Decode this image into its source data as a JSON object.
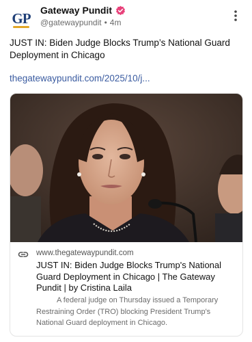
{
  "account": {
    "avatar_text": "GP",
    "display_name": "Gateway Pundit",
    "handle": "@gatewaypundit",
    "separator": "•",
    "time": "4m"
  },
  "post": {
    "text": "JUST IN: Biden Judge Blocks Trump’s National Guard Deployment in Chicago",
    "link": "thegatewaypundit.com/2025/10/j..."
  },
  "card": {
    "domain": "www.thegatewaypundit.com",
    "title": "JUST IN: Biden Judge Blocks Trump's National Guard Deployment in Chicago | The Gateway Pundit | by Cristina Laila",
    "description": "A federal judge on Thursday issued a Temporary Restraining Order (TRO) blocking President Trump's National Guard deployment in Chicago."
  },
  "colors": {
    "brand_navy": "#1f3f77",
    "brand_gold": "#e2a728",
    "verified": "#e8417a",
    "link": "#3a5ba0"
  },
  "icons": [
    "verified-badge-icon",
    "more-options-icon",
    "link-icon"
  ]
}
